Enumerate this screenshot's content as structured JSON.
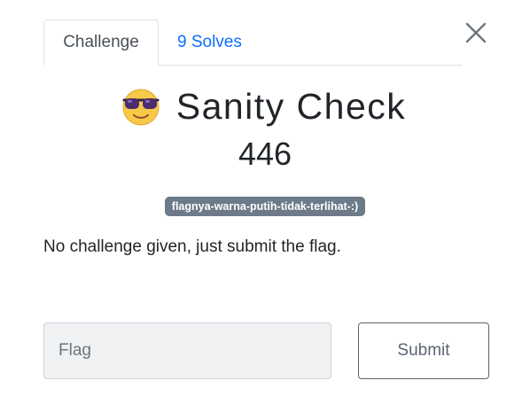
{
  "tabs": [
    {
      "label": "Challenge",
      "active": true
    },
    {
      "label": "9 Solves",
      "active": false
    }
  ],
  "challenge": {
    "icon": "sunglasses-smiley-icon",
    "name": "Sanity Check",
    "points": "446",
    "tag": "flagnya-warna-putih-tidak-terlihat-:)",
    "description": "No challenge given, just submit the flag."
  },
  "form": {
    "flag_placeholder": "Flag",
    "flag_value": "",
    "submit_label": "Submit"
  },
  "colors": {
    "accent": "#0d6efd",
    "tag_bg": "#6c7a89",
    "input_bg": "#eff1f3"
  }
}
